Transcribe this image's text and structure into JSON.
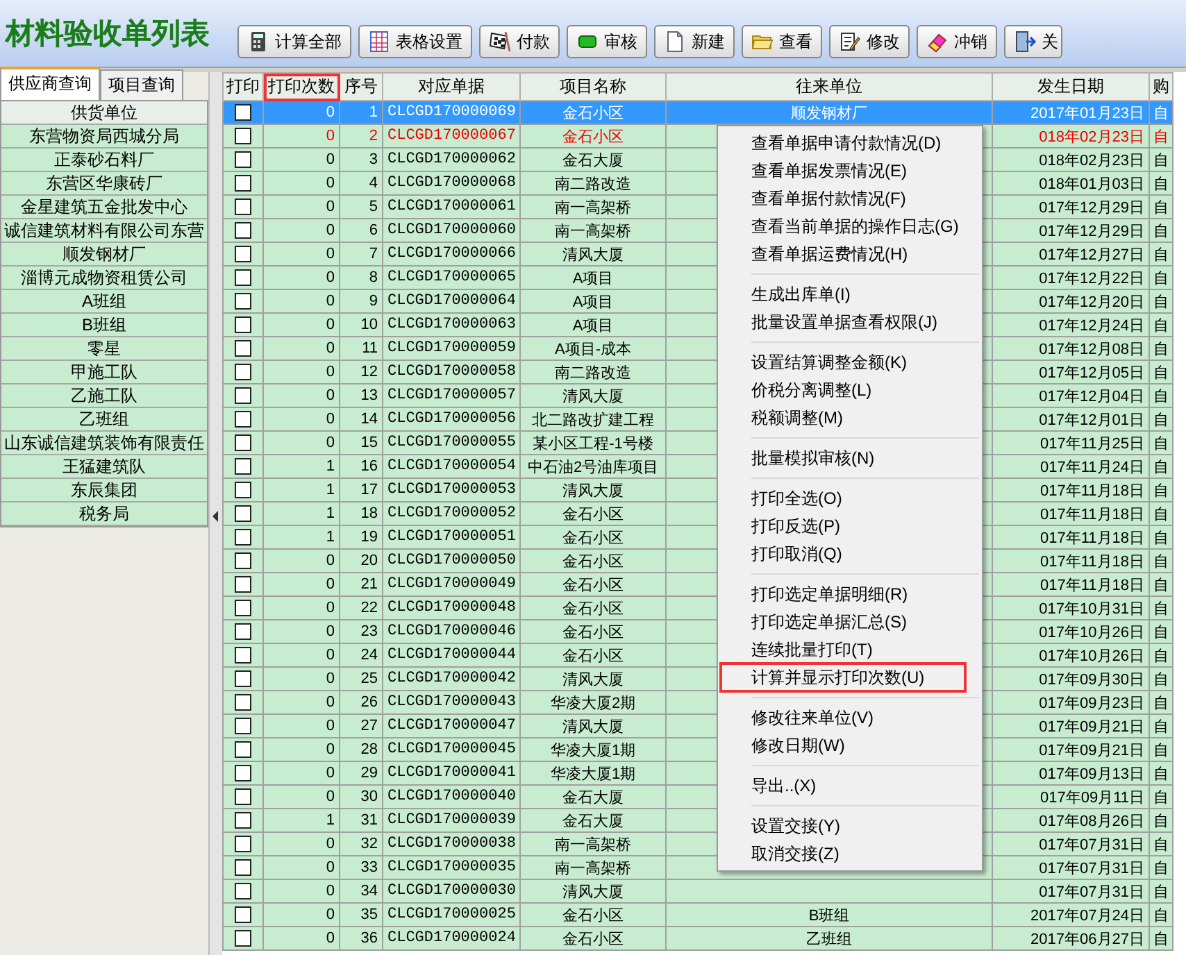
{
  "title": "材料验收单列表",
  "toolbar": [
    {
      "label": "计算全部"
    },
    {
      "label": "表格设置"
    },
    {
      "label": "付款"
    },
    {
      "label": "审核"
    },
    {
      "label": "新建"
    },
    {
      "label": "查看"
    },
    {
      "label": "修改"
    },
    {
      "label": "冲销"
    },
    {
      "label": "关"
    }
  ],
  "side_tabs": [
    {
      "label": "供应商查询",
      "selected": true
    },
    {
      "label": "项目查询",
      "selected": false
    }
  ],
  "supplier_list": {
    "header": "供货单位",
    "items": [
      "东营物资局西城分局",
      "正泰砂石料厂",
      "东营区华康砖厂",
      "金星建筑五金批发中心",
      "诚信建筑材料有限公司东营",
      "顺发钢材厂",
      "淄博元成物资租赁公司",
      "A班组",
      "B班组",
      "零星",
      "甲施工队",
      "乙施工队",
      "乙班组",
      "山东诚信建筑装饰有限责任",
      "王猛建筑队",
      "东辰集团",
      "税务局"
    ]
  },
  "table": {
    "columns": [
      {
        "label": "打印",
        "highlighted": false
      },
      {
        "label": "打印次数",
        "highlighted": true
      },
      {
        "label": "序号",
        "highlighted": false
      },
      {
        "label": "对应单据",
        "highlighted": false
      },
      {
        "label": "项目名称",
        "highlighted": false
      },
      {
        "label": "往来单位",
        "highlighted": false
      },
      {
        "label": "发生日期",
        "highlighted": false
      },
      {
        "label": "购",
        "highlighted": false
      }
    ],
    "rows": [
      {
        "checked": false,
        "count": "0",
        "no": "1",
        "doc": "CLCGD170000069",
        "project": "金石小区",
        "partner": "顺发钢材厂",
        "date": "2017年01月23日",
        "buy": "自",
        "selected": true,
        "warning": false
      },
      {
        "checked": false,
        "count": "0",
        "no": "2",
        "doc": "CLCGD170000067",
        "project": "金石小区",
        "date": "018年02月23日",
        "buy": "自",
        "selected": false,
        "warning": true
      },
      {
        "checked": false,
        "count": "0",
        "no": "3",
        "doc": "CLCGD170000062",
        "project": "金石大厦",
        "date": "018年02月23日",
        "buy": "自",
        "selected": false,
        "warning": false
      },
      {
        "checked": false,
        "count": "0",
        "no": "4",
        "doc": "CLCGD170000068",
        "project": "南二路改造",
        "date": "018年01月03日",
        "buy": "自",
        "selected": false,
        "warning": false
      },
      {
        "checked": false,
        "count": "0",
        "no": "5",
        "doc": "CLCGD170000061",
        "project": "南一高架桥",
        "date": "017年12月29日",
        "buy": "自",
        "selected": false,
        "warning": false
      },
      {
        "checked": false,
        "count": "0",
        "no": "6",
        "doc": "CLCGD170000060",
        "project": "南一高架桥",
        "date": "017年12月29日",
        "buy": "自",
        "selected": false,
        "warning": false
      },
      {
        "checked": false,
        "count": "0",
        "no": "7",
        "doc": "CLCGD170000066",
        "project": "清风大厦",
        "date": "017年12月27日",
        "buy": "自",
        "selected": false,
        "warning": false
      },
      {
        "checked": false,
        "count": "0",
        "no": "8",
        "doc": "CLCGD170000065",
        "project": "A项目",
        "date": "017年12月22日",
        "buy": "自",
        "selected": false,
        "warning": false
      },
      {
        "checked": false,
        "count": "0",
        "no": "9",
        "doc": "CLCGD170000064",
        "project": "A项目",
        "date": "017年12月20日",
        "buy": "自",
        "selected": false,
        "warning": false
      },
      {
        "checked": false,
        "count": "0",
        "no": "10",
        "doc": "CLCGD170000063",
        "project": "A项目",
        "date": "017年12月24日",
        "buy": "自",
        "selected": false,
        "warning": false
      },
      {
        "checked": false,
        "count": "0",
        "no": "11",
        "doc": "CLCGD170000059",
        "project": "A项目-成本",
        "date": "017年12月08日",
        "buy": "自",
        "selected": false,
        "warning": false
      },
      {
        "checked": false,
        "count": "0",
        "no": "12",
        "doc": "CLCGD170000058",
        "project": "南二路改造",
        "date": "017年12月05日",
        "buy": "自",
        "selected": false,
        "warning": false
      },
      {
        "checked": false,
        "count": "0",
        "no": "13",
        "doc": "CLCGD170000057",
        "project": "清风大厦",
        "date": "017年12月04日",
        "buy": "自",
        "selected": false,
        "warning": false
      },
      {
        "checked": false,
        "count": "0",
        "no": "14",
        "doc": "CLCGD170000056",
        "project": "北二路改扩建工程",
        "date": "017年12月01日",
        "buy": "自",
        "selected": false,
        "warning": false
      },
      {
        "checked": false,
        "count": "0",
        "no": "15",
        "doc": "CLCGD170000055",
        "project": "某小区工程-1号楼",
        "date": "017年11月25日",
        "buy": "自",
        "selected": false,
        "warning": false
      },
      {
        "checked": false,
        "count": "1",
        "no": "16",
        "doc": "CLCGD170000054",
        "project": "中石油2号油库项目",
        "date": "017年11月24日",
        "buy": "自",
        "selected": false,
        "warning": false
      },
      {
        "checked": false,
        "count": "1",
        "no": "17",
        "doc": "CLCGD170000053",
        "project": "清风大厦",
        "date": "017年11月18日",
        "buy": "自",
        "selected": false,
        "warning": false
      },
      {
        "checked": false,
        "count": "1",
        "no": "18",
        "doc": "CLCGD170000052",
        "project": "金石小区",
        "date": "017年11月18日",
        "buy": "自",
        "selected": false,
        "warning": false
      },
      {
        "checked": false,
        "count": "1",
        "no": "19",
        "doc": "CLCGD170000051",
        "project": "金石小区",
        "date": "017年11月18日",
        "buy": "自",
        "selected": false,
        "warning": false
      },
      {
        "checked": false,
        "count": "0",
        "no": "20",
        "doc": "CLCGD170000050",
        "project": "金石小区",
        "date": "017年11月18日",
        "buy": "自",
        "selected": false,
        "warning": false
      },
      {
        "checked": false,
        "count": "0",
        "no": "21",
        "doc": "CLCGD170000049",
        "project": "金石小区",
        "date": "017年11月18日",
        "buy": "自",
        "selected": false,
        "warning": false
      },
      {
        "checked": false,
        "count": "0",
        "no": "22",
        "doc": "CLCGD170000048",
        "project": "金石小区",
        "date": "017年10月31日",
        "buy": "自",
        "selected": false,
        "warning": false
      },
      {
        "checked": false,
        "count": "0",
        "no": "23",
        "doc": "CLCGD170000046",
        "project": "金石小区",
        "date": "017年10月26日",
        "buy": "自",
        "selected": false,
        "warning": false
      },
      {
        "checked": false,
        "count": "0",
        "no": "24",
        "doc": "CLCGD170000044",
        "project": "金石小区",
        "date": "017年10月26日",
        "buy": "自",
        "selected": false,
        "warning": false
      },
      {
        "checked": false,
        "count": "0",
        "no": "25",
        "doc": "CLCGD170000042",
        "project": "清风大厦",
        "date": "017年09月30日",
        "buy": "自",
        "selected": false,
        "warning": false
      },
      {
        "checked": false,
        "count": "0",
        "no": "26",
        "doc": "CLCGD170000043",
        "project": "华凌大厦2期",
        "date": "017年09月23日",
        "buy": "自",
        "selected": false,
        "warning": false
      },
      {
        "checked": false,
        "count": "0",
        "no": "27",
        "doc": "CLCGD170000047",
        "project": "清风大厦",
        "date": "017年09月21日",
        "buy": "自",
        "selected": false,
        "warning": false
      },
      {
        "checked": false,
        "count": "0",
        "no": "28",
        "doc": "CLCGD170000045",
        "project": "华凌大厦1期",
        "date": "017年09月21日",
        "buy": "自",
        "selected": false,
        "warning": false
      },
      {
        "checked": false,
        "count": "0",
        "no": "29",
        "doc": "CLCGD170000041",
        "project": "华凌大厦1期",
        "date": "017年09月13日",
        "buy": "自",
        "selected": false,
        "warning": false
      },
      {
        "checked": false,
        "count": "0",
        "no": "30",
        "doc": "CLCGD170000040",
        "project": "金石大厦",
        "date": "017年09月11日",
        "buy": "自",
        "selected": false,
        "warning": false
      },
      {
        "checked": false,
        "count": "1",
        "no": "31",
        "doc": "CLCGD170000039",
        "project": "金石大厦",
        "date": "017年08月26日",
        "buy": "自",
        "selected": false,
        "warning": false
      },
      {
        "checked": false,
        "count": "0",
        "no": "32",
        "doc": "CLCGD170000038",
        "project": "南一高架桥",
        "date": "017年07月31日",
        "buy": "自",
        "selected": false,
        "warning": false
      },
      {
        "checked": false,
        "count": "0",
        "no": "33",
        "doc": "CLCGD170000035",
        "project": "南一高架桥",
        "date": "017年07月31日",
        "buy": "自",
        "selected": false,
        "warning": false
      },
      {
        "checked": false,
        "count": "0",
        "no": "34",
        "doc": "CLCGD170000030",
        "project": "清风大厦",
        "date": "017年07月31日",
        "buy": "自",
        "selected": false,
        "warning": false
      },
      {
        "checked": false,
        "count": "0",
        "no": "35",
        "doc": "CLCGD170000025",
        "project": "金石小区",
        "partner": "B班组",
        "date": "2017年07月24日",
        "buy": "自",
        "selected": false,
        "warning": false
      },
      {
        "checked": false,
        "count": "0",
        "no": "36",
        "doc": "CLCGD170000024",
        "project": "金石小区",
        "partner": "乙班组",
        "date": "2017年06月27日",
        "buy": "自",
        "selected": false,
        "warning": false
      }
    ]
  },
  "context_menu": {
    "groups": [
      [
        {
          "label": "查看单据申请付款情况(D)",
          "highlighted": false
        },
        {
          "label": "查看单据发票情况(E)",
          "highlighted": false
        },
        {
          "label": "查看单据付款情况(F)",
          "highlighted": false
        },
        {
          "label": "查看当前单据的操作日志(G)",
          "highlighted": false
        },
        {
          "label": "查看单据运费情况(H)",
          "highlighted": false
        }
      ],
      [
        {
          "label": "生成出库单(I)",
          "highlighted": false
        },
        {
          "label": "批量设置单据查看权限(J)",
          "highlighted": false
        }
      ],
      [
        {
          "label": "设置结算调整金额(K)",
          "highlighted": false
        },
        {
          "label": "价税分离调整(L)",
          "highlighted": false
        },
        {
          "label": "税额调整(M)",
          "highlighted": false
        }
      ],
      [
        {
          "label": "批量模拟审核(N)",
          "highlighted": false
        }
      ],
      [
        {
          "label": "打印全选(O)",
          "highlighted": false
        },
        {
          "label": "打印反选(P)",
          "highlighted": false
        },
        {
          "label": "打印取消(Q)",
          "highlighted": false
        }
      ],
      [
        {
          "label": "打印选定单据明细(R)",
          "highlighted": false
        },
        {
          "label": "打印选定单据汇总(S)",
          "highlighted": false
        },
        {
          "label": "连续批量打印(T)",
          "highlighted": false
        },
        {
          "label": "计算并显示打印次数(U)",
          "highlighted": true
        }
      ],
      [
        {
          "label": "修改往来单位(V)",
          "highlighted": false
        },
        {
          "label": "修改日期(W)",
          "highlighted": false
        }
      ],
      [
        {
          "label": "导出..(X)",
          "highlighted": false
        }
      ],
      [
        {
          "label": "设置交接(Y)",
          "highlighted": false
        },
        {
          "label": "取消交接(Z)",
          "highlighted": false
        }
      ]
    ]
  }
}
